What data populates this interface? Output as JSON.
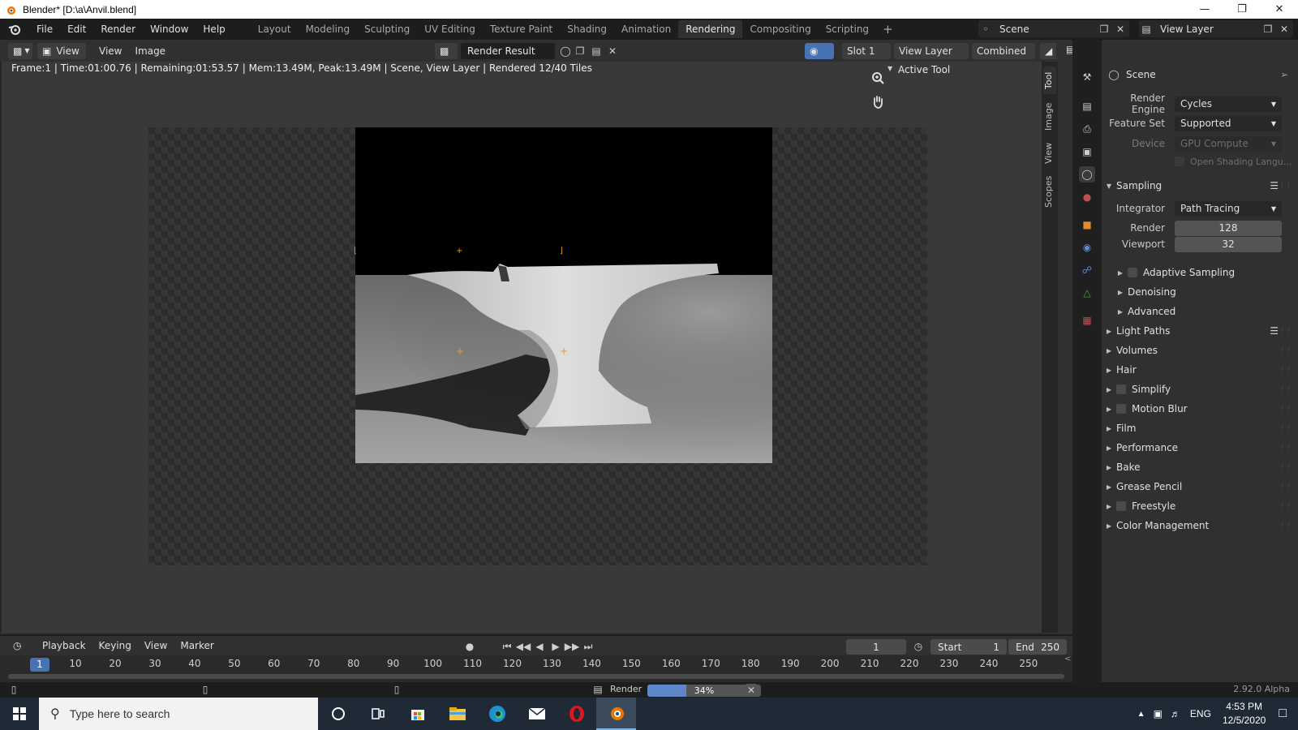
{
  "window": {
    "title": "Blender* [D:\\a\\Anvil.blend]"
  },
  "menu": [
    "File",
    "Edit",
    "Render",
    "Window",
    "Help"
  ],
  "workspaces": [
    "Layout",
    "Modeling",
    "Sculpting",
    "UV Editing",
    "Texture Paint",
    "Shading",
    "Animation",
    "Rendering",
    "Compositing",
    "Scripting"
  ],
  "active_workspace": "Rendering",
  "scene_name": "Scene",
  "view_layer_name": "View Layer",
  "image_editor": {
    "view_dd": "View",
    "menu_view": "View",
    "menu_image": "Image",
    "image_name": "Render Result",
    "slot": "Slot 1",
    "layer": "View Layer",
    "pass": "Combined",
    "status": "Frame:1 | Time:01:00.76 | Remaining:01:53.57 | Mem:13.49M, Peak:13.49M | Scene, View Layer | Rendered 12/40 Tiles",
    "active_tool": "Active Tool",
    "side_tabs": [
      "Tool",
      "Image",
      "View",
      "Scopes"
    ]
  },
  "properties": {
    "context": "Scene",
    "render_engine_label": "Render Engine",
    "render_engine": "Cycles",
    "feature_set_label": "Feature Set",
    "feature_set": "Supported",
    "device_label": "Device",
    "device": "GPU Compute",
    "osl": "Open Shading Langu...",
    "sampling": "Sampling",
    "integrator_label": "Integrator",
    "integrator": "Path Tracing",
    "render_label": "Render",
    "render_samples": "128",
    "viewport_label": "Viewport",
    "viewport_samples": "32",
    "sub": [
      "Adaptive Sampling",
      "Denoising",
      "Advanced"
    ],
    "sections": [
      "Light Paths",
      "Volumes",
      "Hair",
      "Simplify",
      "Motion Blur",
      "Film",
      "Performance",
      "Bake",
      "Grease Pencil",
      "Freestyle",
      "Color Management"
    ]
  },
  "timeline": {
    "menus": [
      "Playback",
      "Keying",
      "View",
      "Marker"
    ],
    "current_frame": "1",
    "start_label": "Start",
    "start": "1",
    "end_label": "End",
    "end": "250",
    "ticks": [
      "10",
      "20",
      "30",
      "40",
      "50",
      "60",
      "70",
      "80",
      "90",
      "100",
      "110",
      "120",
      "130",
      "140",
      "150",
      "160",
      "170",
      "180",
      "190",
      "200",
      "210",
      "220",
      "230",
      "240",
      "250"
    ],
    "cur_tick": "1"
  },
  "statusbar": {
    "render_label": "Render",
    "progress_text": "34%",
    "progress": 0.34,
    "version": "2.92.0 Alpha"
  },
  "taskbar": {
    "search_placeholder": "Type here to search",
    "lang": "ENG",
    "time": "4:53 PM",
    "date": "12/5/2020"
  },
  "colors": {
    "accent": "#4772b3",
    "progress": "#5e86c9"
  }
}
